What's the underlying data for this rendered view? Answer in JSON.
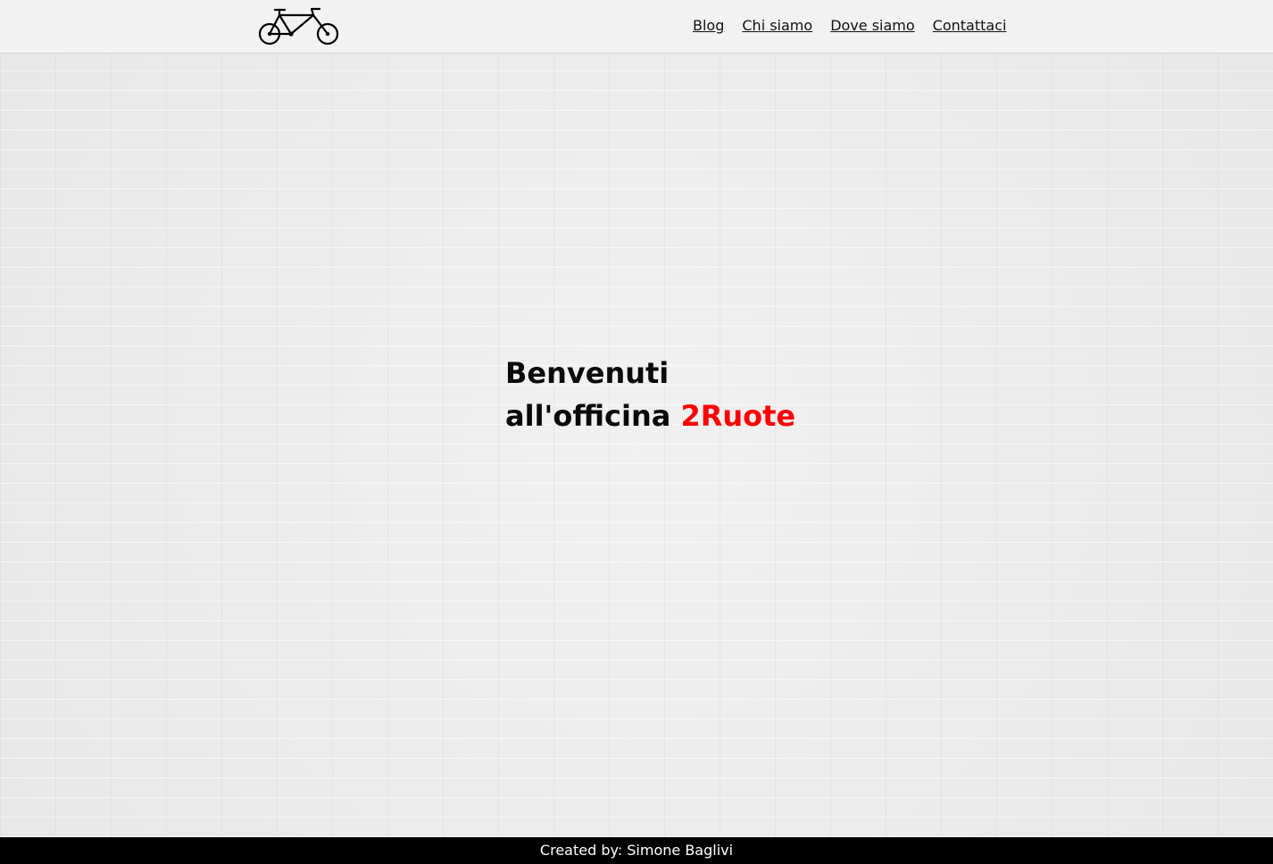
{
  "header": {
    "logo_icon": "bicycle-icon",
    "nav": [
      {
        "label": "Blog"
      },
      {
        "label": "Chi siamo"
      },
      {
        "label": "Dove siamo"
      },
      {
        "label": "Contattaci"
      }
    ]
  },
  "hero": {
    "line1": "Benvenuti",
    "line2": "all'officina",
    "brand": "2Ruote",
    "brand_color": "#ff0000"
  },
  "footer": {
    "credit": "Created by: Simone Baglivi"
  }
}
